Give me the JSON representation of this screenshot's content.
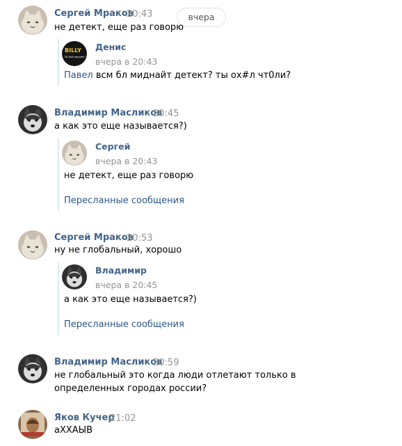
{
  "date_divider": "вчера",
  "messages": [
    {
      "author": "Сергей Мраков",
      "time": "20:43",
      "text": "не детект, еще раз говорю",
      "forwarded": {
        "author": "Денис",
        "time": "вчера в 20:43",
        "mention": "Павел",
        "text": " всм бл миднайт детект? ты ох#л чт0ли?"
      }
    },
    {
      "author": "Владимир Масликов",
      "time": "20:45",
      "text": "а как это еще называется?)",
      "forwarded": {
        "author": "Сергей",
        "time": "вчера в 20:43",
        "text": "не детект, еще раз говорю",
        "link": "Пересланные сообщения"
      }
    },
    {
      "author": "Сергей Мраков",
      "time": "20:53",
      "text": "ну не глобальный, хорошо",
      "forwarded": {
        "author": "Владимир",
        "time": "вчера в 20:45",
        "text": "а как это еще называется?)",
        "link": "Пересланные сообщения"
      }
    },
    {
      "author": "Владимир Масликов",
      "time": "20:59",
      "text": "не глобальный это когда люди отлетают только в определенных городах россии?"
    },
    {
      "author": "Яков Кучер",
      "time": "21:02",
      "text": "аХХАЫВ"
    }
  ],
  "avatar_logo": {
    "brand": "BILLY",
    "tagline": "\"ID DxB requires\""
  },
  "colors": {
    "author": "#42648b",
    "link": "#2a5885",
    "time": "#939393",
    "quote_border": "#dfe6ee"
  }
}
